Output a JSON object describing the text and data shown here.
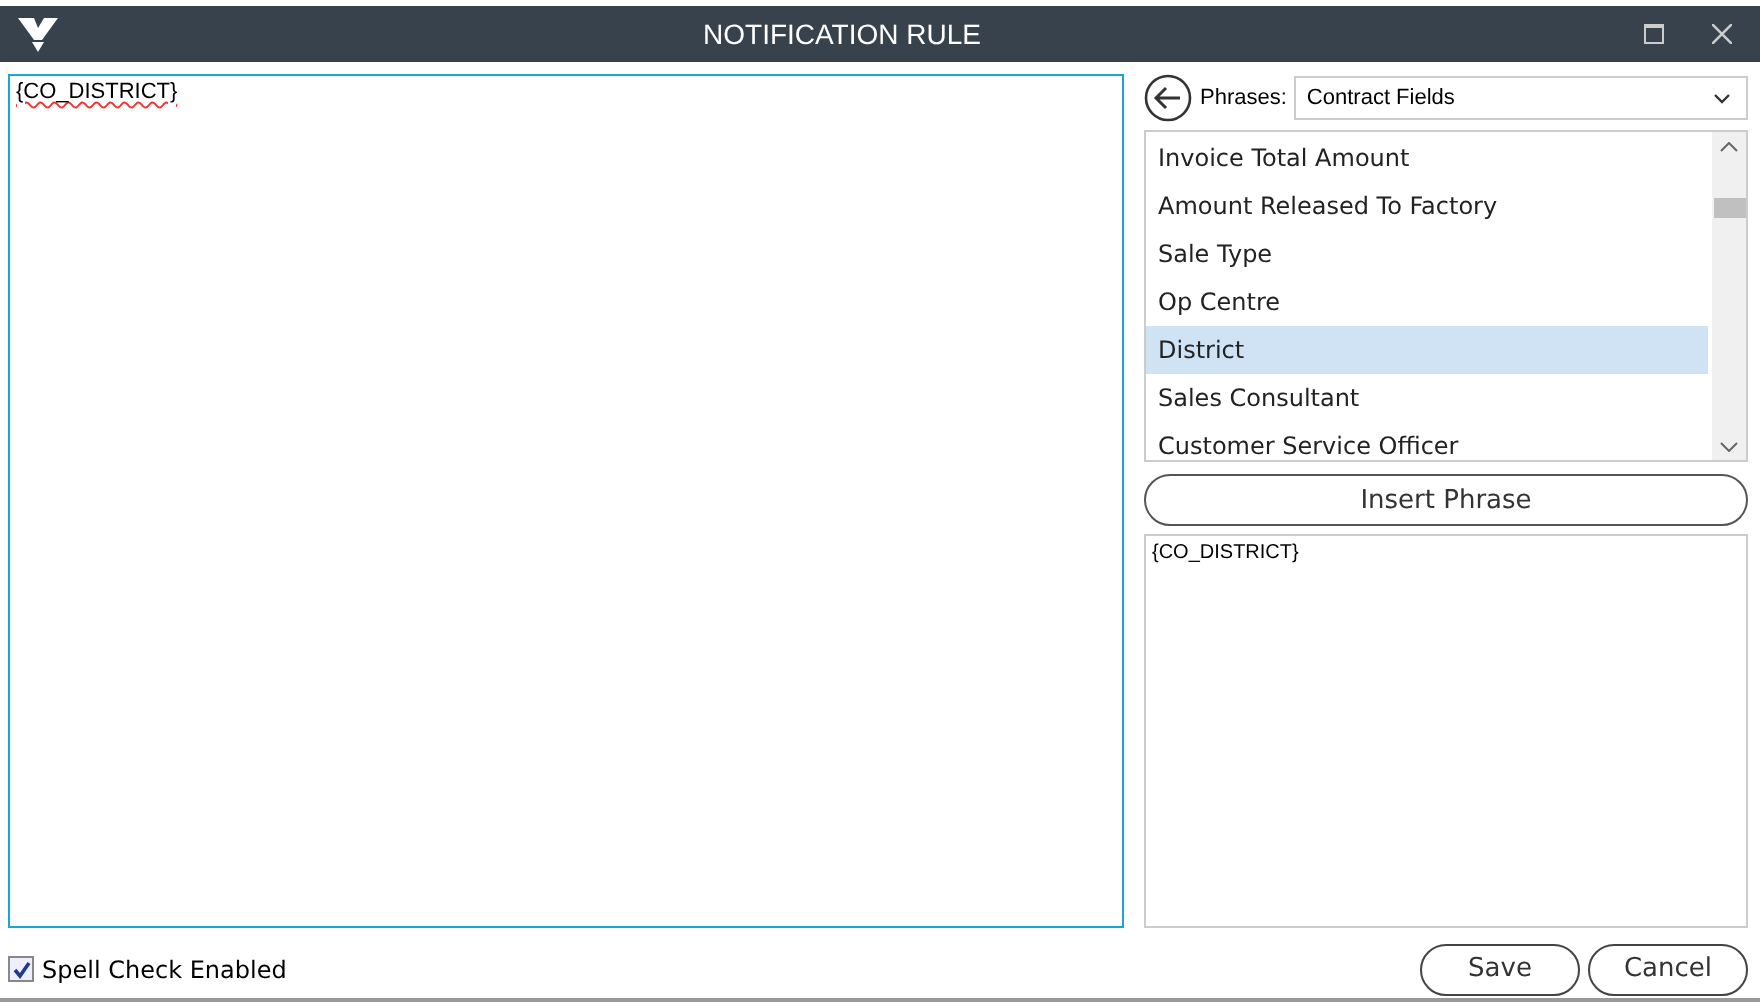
{
  "window": {
    "title": "NOTIFICATION RULE"
  },
  "editor": {
    "value": "{CO_DISTRICT}"
  },
  "phrases": {
    "label": "Phrases:",
    "category": "Contract Fields"
  },
  "phrase_list": [
    {
      "label": "Invoice Total Amount",
      "selected": false
    },
    {
      "label": "Amount Released To Factory",
      "selected": false
    },
    {
      "label": "Sale Type",
      "selected": false
    },
    {
      "label": "Op Centre",
      "selected": false
    },
    {
      "label": "District",
      "selected": true
    },
    {
      "label": "Sales Consultant",
      "selected": false
    },
    {
      "label": "Customer Service Officer",
      "selected": false
    }
  ],
  "insert_button": "Insert Phrase",
  "preview": "{CO_DISTRICT}",
  "spell_check": {
    "label": "Spell Check Enabled",
    "checked": true
  },
  "buttons": [
    "Save",
    "Cancel"
  ]
}
